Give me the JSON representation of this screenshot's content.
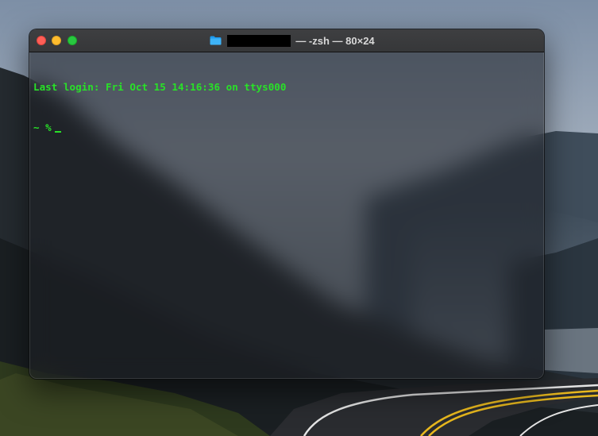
{
  "window": {
    "title_suffix": "— -zsh — 80×24",
    "title_folder_icon": "folder-icon",
    "traffic_lights": {
      "close_color": "#fe5f57",
      "minimize_color": "#febc2e",
      "zoom_color": "#28c840"
    }
  },
  "terminal": {
    "text_color": "#29e128",
    "last_login": "Last login: Fri Oct 15 14:16:36 on ttys000",
    "prompt": "~ %"
  }
}
